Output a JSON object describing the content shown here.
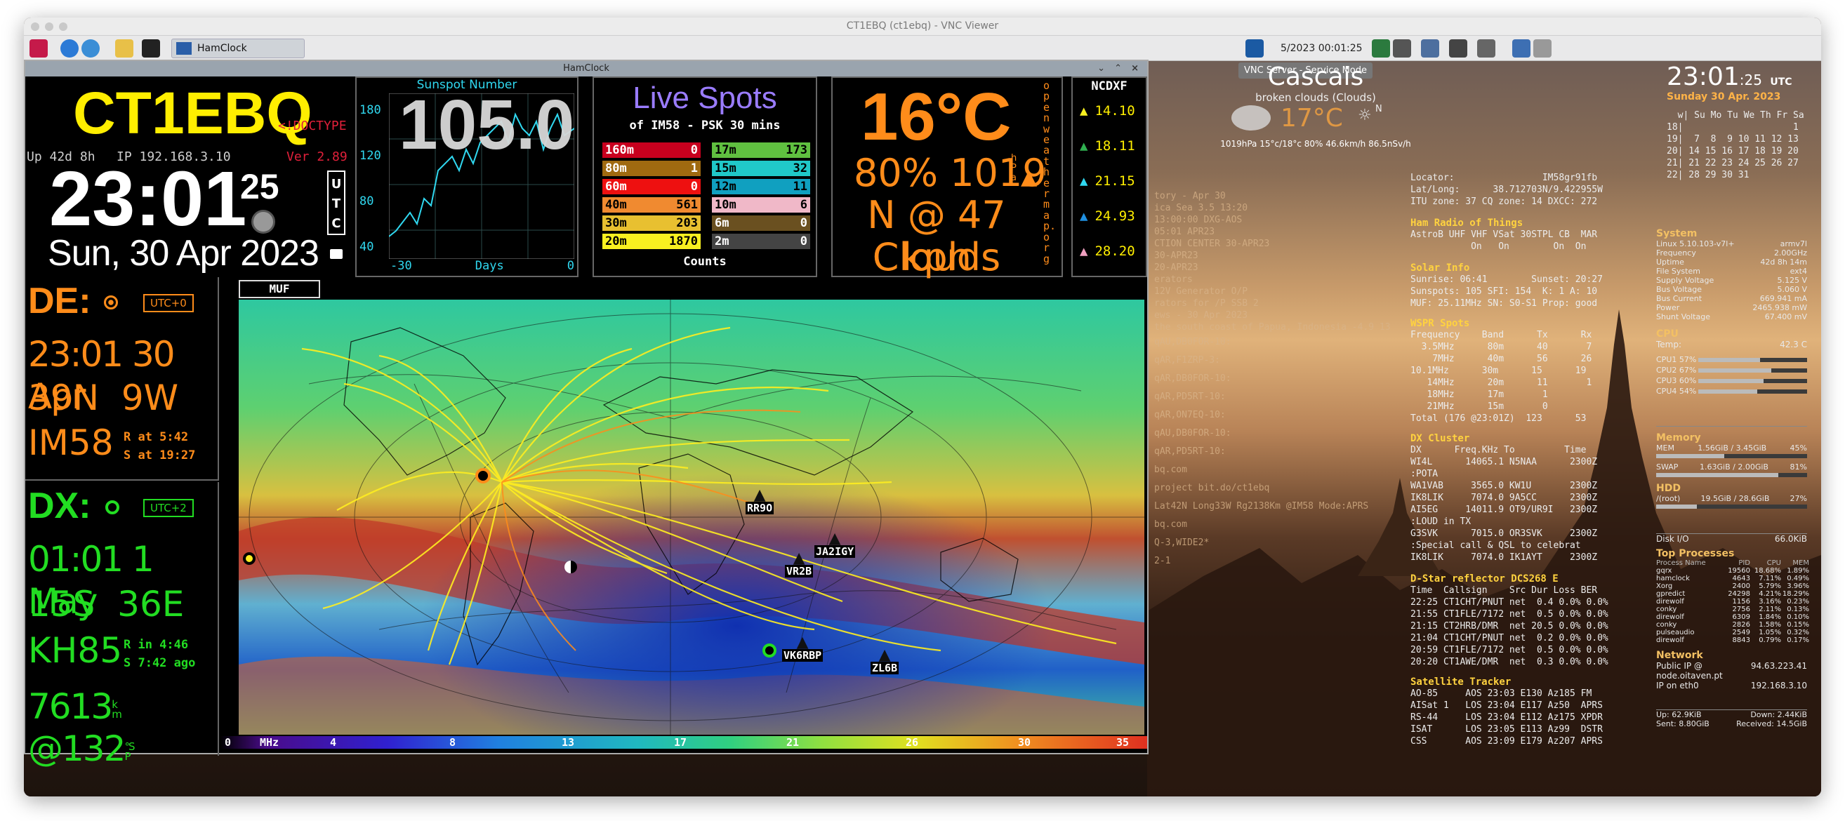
{
  "vnc": {
    "title": "CT1EBQ (ct1ebq) - VNC Viewer",
    "tooltip": "VNC Server - Service Mode",
    "clock": "5/2023 00:01:25"
  },
  "panel": {
    "app_button": "HamClock"
  },
  "hamclock": {
    "window_title": "HamClock",
    "call": "CT1EBQ",
    "doctype": "<!DOCTYPE h",
    "uptime": "Up 42d 8h",
    "ip": "IP 192.168.3.10",
    "version": "Ver 2.89",
    "time": "23:01",
    "seconds": "25",
    "utc": "UTC",
    "date": "Sun, 30 Apr 2023",
    "sunspot": {
      "title": "Sunspot Number",
      "value": "105.0",
      "yticks": [
        "180",
        "120",
        "80",
        "40"
      ],
      "xticks": [
        "-30",
        "Days",
        "0"
      ]
    },
    "live": {
      "title": "Live Spots",
      "sub": "of IM58 - PSK 30 mins",
      "counts": "Counts",
      "left": [
        {
          "band": "160m",
          "n": "0",
          "bg": "#c8001e",
          "fg": "#fff"
        },
        {
          "band": "80m",
          "n": "1",
          "bg": "#a06a10",
          "fg": "#fff"
        },
        {
          "band": "60m",
          "n": "0",
          "bg": "#ee1010",
          "fg": "#fff"
        },
        {
          "band": "40m",
          "n": "561",
          "bg": "#f08a30",
          "fg": "#000"
        },
        {
          "band": "30m",
          "n": "203",
          "bg": "#e8c030",
          "fg": "#000"
        },
        {
          "band": "20m",
          "n": "1870",
          "bg": "#f8f020",
          "fg": "#000"
        }
      ],
      "right": [
        {
          "band": "17m",
          "n": "173",
          "bg": "#60c040",
          "fg": "#000"
        },
        {
          "band": "15m",
          "n": "32",
          "bg": "#20c8c8",
          "fg": "#000"
        },
        {
          "band": "12m",
          "n": "11",
          "bg": "#10a0c0",
          "fg": "#000"
        },
        {
          "band": "10m",
          "n": "6",
          "bg": "#f0b8c8",
          "fg": "#000"
        },
        {
          "band": "6m",
          "n": "0",
          "bg": "#6a5020",
          "fg": "#fff"
        },
        {
          "band": "2m",
          "n": "0",
          "bg": "#444",
          "fg": "#fff"
        }
      ]
    },
    "wx": {
      "temp": "16°C",
      "hum": "80%",
      "pres": "1019",
      "unit": "hPa",
      "wind": "N @ 47 kph",
      "cond": "Clouds",
      "source": "openweathermap.org"
    },
    "ncdxf": {
      "title": "NCDXF",
      "rows": [
        {
          "f": "14.10",
          "c": "#f8f020"
        },
        {
          "f": "18.11",
          "c": "#30b050"
        },
        {
          "f": "21.15",
          "c": "#30d8f0"
        },
        {
          "f": "24.93",
          "c": "#2090e0"
        },
        {
          "f": "28.20",
          "c": "#f0a0c0"
        }
      ]
    },
    "de": {
      "label": "DE:",
      "utc": "UTC+0",
      "time": "23:01 30 Apr",
      "coords": "39N  9W",
      "grid": "IM58",
      "rise": "R at 5:42",
      "set": "S at 19:27"
    },
    "dx": {
      "label": "DX:",
      "utc": "UTC+2",
      "time": "01:01 1 May",
      "coords": "15S  36E",
      "grid": "KH85",
      "rise": "R in 4:46",
      "set": "S 7:42 ago",
      "dist": "7613",
      "dist_unit": "km",
      "bearing": "@132",
      "bearing_unit": "°SP"
    },
    "map": {
      "mode": "MUF",
      "scale": [
        "0",
        "MHz",
        "4",
        "8",
        "13",
        "17",
        "21",
        "26",
        "30",
        "35"
      ],
      "labels": [
        "RR9O",
        "JA2IGY",
        "VR2B",
        "VK6RBP",
        "ZL6B"
      ]
    }
  },
  "weather_widget": {
    "city": "Cascais",
    "desc": "broken clouds (Clouds)",
    "temp": "17°C",
    "details": "1019hPa 15°c/18°c 80% 46.6km/h 86.5nSv/h",
    "wind_dir": "N"
  },
  "clock_widget": {
    "time": "23:01",
    "sec": ":25",
    "tz": "UTC",
    "date": "Sunday 30 Apr. 2023",
    "cal_head": "  w| Su Mo Tu We Th Fr Sa",
    "cal_rows": [
      "18|                    1",
      "19|  7  8  9 10 11 12 13",
      "20| 14 15 16 17 18 19 20",
      "21| 21 22 23 24 25 26 27",
      "22| 28 29 30 31"
    ]
  },
  "info": {
    "locator": "Locator:                IM58gr91fb",
    "latlong": "Lat/Long:      38.712703N/9.422955W",
    "ituz": "ITU zone: 37 CQ zone: 14 DXCC: 272",
    "things_h": "Ham Radio of Things",
    "things": "AstroB UHF VHF VSat 30STPL CB  MAR",
    "things2": "           On   On        On  On",
    "solar_h": "Solar Info",
    "solar": [
      "Sunrise: 06:41        Sunset: 20:27",
      "Sunspots: 105 SFI: 154  K: 1 A: 10",
      "MUF: 25.11MHz SN: S0-S1 Prop: good"
    ],
    "wspr_h": "WSPR Spots",
    "wspr": [
      "Frequency    Band      Tx      Rx",
      "  3.5MHz      80m      40       7",
      "    7MHz      40m      56      26",
      "10.1MHz      30m      15      19",
      "   14MHz      20m      11       1",
      "   18MHz      17m       1",
      "   21MHz      15m       0",
      "Total (176 @23:01Z)  123      53"
    ],
    "dx_h": "DX Cluster",
    "dx": [
      "DX      Freq.KHz To         Time",
      "WI4L      14065.1 N5NAA      2300Z",
      ":POTA",
      "WA1VAB     3565.0 KW1U       2300Z",
      "IK8LIK     7074.0 9A5CC      2300Z",
      "AI5EG     14011.9 OT9/UR9I   2300Z",
      ":LOUD in TX",
      "G3SVK      7015.0 OR3SVK     2300Z",
      ":Special call & QSL to celebrat",
      "IK8LIK     7074.0 IK1AYT     2300Z"
    ],
    "dstar_h": "D-Star reflector DCS268 E",
    "dstar": [
      "Time  Callsign    Src Dur Loss BER",
      "22:25 CT1CHT/PNUT net  0.4 0.0% 0.0%",
      "21:55 CT1FLE/7172 net  0.5 0.0% 0.0%",
      "21:15 CT2HRB/DMR  net 20.5 0.0% 0.0%",
      "21:04 CT1CHT/PNUT net  0.2 0.0% 0.0%",
      "20:59 CT1FLE/7172 net  0.5 0.0% 0.0%",
      "20:20 CT1AWE/DMR  net  0.3 0.0% 0.0%"
    ],
    "sat_h": "Satellite Tracker",
    "sat": [
      "AO-85     AOS 23:03 E130 Az185 FM",
      "AISat 1   LOS 23:04 E117 Az50  APRS",
      "RS-44     LOS 23:04 E112 Az175 XPDR",
      "ISAT      LOS 23:05 E113 Az99  DSTR",
      "CSS       AOS 23:09 E179 Az207 APRS"
    ]
  },
  "conky": {
    "system_h": "System",
    "system": [
      [
        "Linux 5.10.103-v7l+",
        "armv7l"
      ],
      [
        "Frequency",
        "2.00GHz"
      ],
      [
        "Uptime",
        "42d 8h 14m"
      ],
      [
        "File System",
        "ext4"
      ],
      [
        "Supply Voltage",
        "5.125 V"
      ],
      [
        "Bus Voltage",
        "5.060 V"
      ],
      [
        "Bus Current",
        "669.941 mA"
      ],
      [
        "Power",
        "2465.938 mW"
      ],
      [
        "Shunt Voltage",
        "67.400 mV"
      ]
    ],
    "cpu_h": "CPU",
    "temp": [
      "Temp:",
      "42.3 C"
    ],
    "cpus": [
      {
        "l": "CPU1 57%",
        "v": 0.57
      },
      {
        "l": "CPU2 67%",
        "v": 0.67
      },
      {
        "l": "CPU3 60%",
        "v": 0.6
      },
      {
        "l": "CPU4 54%",
        "v": 0.54
      }
    ],
    "mem_h": "Memory",
    "mem": [
      [
        "MEM",
        "1.56GiB / 3.45GiB",
        "45%",
        0.45
      ],
      [
        "SWAP",
        "1.63GiB / 2.00GiB",
        "81%",
        0.81
      ]
    ],
    "hdd_h": "HDD",
    "hdd": [
      [
        "/(root)",
        "19.5GiB / 28.6GiB",
        "27%",
        0.27
      ]
    ],
    "diskio": [
      "Disk I/O",
      "66.0KiB"
    ],
    "top_h": "Top Processes",
    "top_head": [
      "Process Name",
      "PID",
      "CPU",
      "MEM"
    ],
    "top": [
      [
        "gqrx",
        "19560",
        "18.68%",
        "1.89%"
      ],
      [
        "hamclock",
        "4643",
        "7.11%",
        "0.49%"
      ],
      [
        "Xorg",
        "2400",
        "5.79%",
        "3.96%"
      ],
      [
        "gpredict",
        "24298",
        "4.21%",
        "18.29%"
      ],
      [
        "direwolf",
        "1156",
        "3.16%",
        "0.23%"
      ],
      [
        "conky",
        "2756",
        "2.11%",
        "0.13%"
      ],
      [
        "direwolf",
        "6309",
        "1.84%",
        "0.10%"
      ],
      [
        "conky",
        "2826",
        "1.58%",
        "0.15%"
      ],
      [
        "pulseaudio",
        "2549",
        "1.05%",
        "0.32%"
      ],
      [
        "direwolf",
        "8843",
        "0.79%",
        "0.17%"
      ]
    ],
    "net_h": "Network",
    "pubip": [
      "Public IP @ node.oitaven.pt",
      "94.63.223.41"
    ],
    "ipeth": [
      "IP on eth0",
      "192.168.3.10"
    ],
    "up": "Up: 62.9KiB",
    "down": "Down: 2.44KiB",
    "sent": "Sent: 8.80GiB",
    "recv": "Received: 14.5GiB"
  },
  "bgtext": [
    "tory - Apr 30",
    "ica Sea 3.5 13:20",
    "13:00:00 DXG-AOS",
    "05:01 APR23",
    "CTION CENTER 30-APR23",
    "30-APR23",
    "20-APR23",
    "erators",
    "12V Generator O/P",
    "rators for /P SSB 2",
    "ews - 30 Apr 2023",
    "the south coast of Papua, Indonesia -4.9 13",
    "qAU,DB0FOR-10:",
    "qAR,F1ZRP-3:",
    "qAR,DB0FOR-10:",
    "qAR,PD5RT-10:",
    "qAR,ON7EQ-10:",
    "qAU,DB0FOR-10:",
    "qAR,PD5RT-10:",
    "bq.com",
    "project bit.do/ct1ebq",
    "Lat42N Long33W Rg2138Km @IM58 Mode:APRS",
    "bq.com",
    "Q-3,WIDE2*",
    "2-1"
  ]
}
